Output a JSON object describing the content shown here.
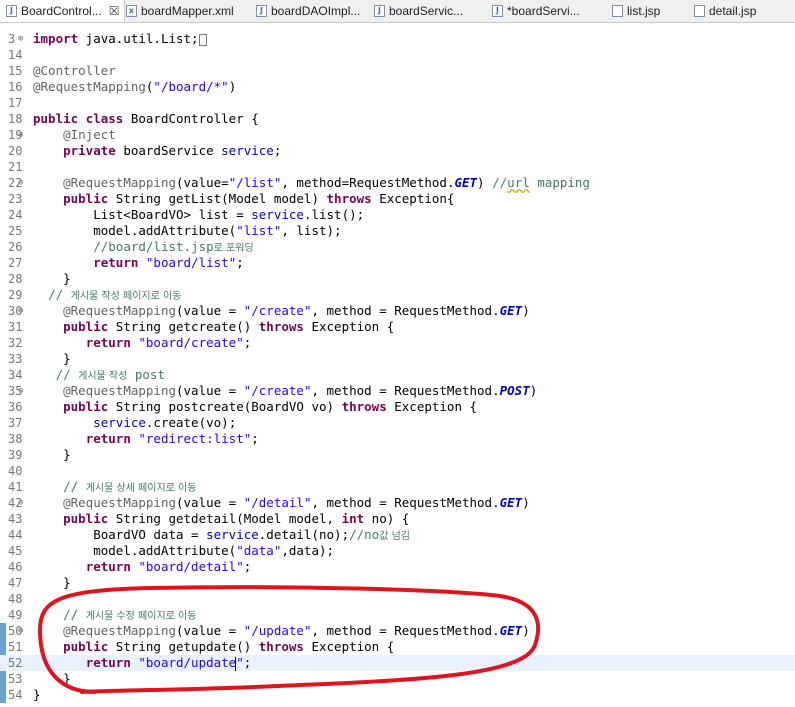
{
  "tabs": [
    {
      "label": "BoardControl...",
      "icon": "java-file-icon",
      "active": true
    },
    {
      "label": "boardMapper.xml",
      "icon": "xml-file-icon",
      "active": false
    },
    {
      "label": "boardDAOImpl...",
      "icon": "java-file-icon",
      "active": false
    },
    {
      "label": "boardServic...",
      "icon": "java-file-icon",
      "active": false
    },
    {
      "label": "*boardServi...",
      "icon": "java-file-icon",
      "active": false
    },
    {
      "label": "list.jsp",
      "icon": "jsp-file-icon",
      "active": false
    },
    {
      "label": "detail.jsp",
      "icon": "jsp-file-icon",
      "active": false
    }
  ],
  "tab_close_glyph": "☒",
  "lines": [
    {
      "n": "3",
      "fold": "⊕",
      "tokens": [
        [
          "kw",
          "import"
        ],
        [
          "tx",
          " java.util.List;"
        ]
      ]
    },
    {
      "n": "14",
      "tokens": []
    },
    {
      "n": "15",
      "tokens": [
        [
          "an",
          "@Controller"
        ]
      ]
    },
    {
      "n": "16",
      "tokens": [
        [
          "an",
          "@RequestMapping"
        ],
        [
          "tx",
          "("
        ],
        [
          "str",
          "\"/board/*\""
        ],
        [
          "tx",
          ")"
        ]
      ]
    },
    {
      "n": "17",
      "tokens": []
    },
    {
      "n": "18",
      "tokens": [
        [
          "kw",
          "public"
        ],
        [
          "tx",
          " "
        ],
        [
          "kw",
          "class"
        ],
        [
          "tx",
          " BoardController {"
        ]
      ]
    },
    {
      "n": "19",
      "fold": "⊖",
      "tokens": [
        [
          "tx",
          "    "
        ],
        [
          "an",
          "@Inject"
        ]
      ]
    },
    {
      "n": "20",
      "tokens": [
        [
          "tx",
          "    "
        ],
        [
          "kw",
          "private"
        ],
        [
          "tx",
          " boardService "
        ],
        [
          "fld",
          "service"
        ],
        [
          "tx",
          ";"
        ]
      ]
    },
    {
      "n": "21",
      "tokens": []
    },
    {
      "n": "22",
      "fold": "⊖",
      "tokens": [
        [
          "tx",
          "    "
        ],
        [
          "an",
          "@RequestMapping"
        ],
        [
          "tx",
          "(value="
        ],
        [
          "str",
          "\"/list\""
        ],
        [
          "tx",
          ", method=RequestMethod."
        ],
        [
          "cst",
          "GET"
        ],
        [
          "tx",
          ") "
        ],
        [
          "cm",
          "//"
        ],
        [
          "cmsq",
          "url"
        ],
        [
          "cm",
          " mapping"
        ]
      ]
    },
    {
      "n": "23",
      "tokens": [
        [
          "tx",
          "    "
        ],
        [
          "kw",
          "public"
        ],
        [
          "tx",
          " String getList(Model model) "
        ],
        [
          "kw",
          "throws"
        ],
        [
          "tx",
          " Exception{"
        ]
      ]
    },
    {
      "n": "24",
      "tokens": [
        [
          "tx",
          "        List<BoardVO> list = "
        ],
        [
          "fld",
          "service"
        ],
        [
          "tx",
          ".list();"
        ]
      ]
    },
    {
      "n": "25",
      "tokens": [
        [
          "tx",
          "        model.addAttribute("
        ],
        [
          "str",
          "\"list\""
        ],
        [
          "tx",
          ", list);"
        ]
      ]
    },
    {
      "n": "26",
      "tokens": [
        [
          "tx",
          "        "
        ],
        [
          "cm",
          "//board/list.jsp"
        ],
        [
          "cmk",
          "로 포워딩"
        ]
      ]
    },
    {
      "n": "27",
      "tokens": [
        [
          "tx",
          "        "
        ],
        [
          "kw",
          "return"
        ],
        [
          "tx",
          " "
        ],
        [
          "str",
          "\"board/list\""
        ],
        [
          "tx",
          ";"
        ]
      ]
    },
    {
      "n": "28",
      "tokens": [
        [
          "tx",
          "    }"
        ]
      ]
    },
    {
      "n": "29",
      "tokens": [
        [
          "tx",
          "  "
        ],
        [
          "cm",
          "// "
        ],
        [
          "cmk",
          "게시물 작성 페이지로 이동"
        ]
      ]
    },
    {
      "n": "30",
      "fold": "⊖",
      "tokens": [
        [
          "tx",
          "    "
        ],
        [
          "an",
          "@RequestMapping"
        ],
        [
          "tx",
          "(value = "
        ],
        [
          "str",
          "\"/create\""
        ],
        [
          "tx",
          ", method = RequestMethod."
        ],
        [
          "cst",
          "GET"
        ],
        [
          "tx",
          ")"
        ]
      ]
    },
    {
      "n": "31",
      "tokens": [
        [
          "tx",
          "    "
        ],
        [
          "kw",
          "public"
        ],
        [
          "tx",
          " String getcreate() "
        ],
        [
          "kw",
          "throws"
        ],
        [
          "tx",
          " Exception {"
        ]
      ]
    },
    {
      "n": "32",
      "tokens": [
        [
          "tx",
          "       "
        ],
        [
          "kw",
          "return"
        ],
        [
          "tx",
          " "
        ],
        [
          "str",
          "\"board/create\""
        ],
        [
          "tx",
          ";"
        ]
      ]
    },
    {
      "n": "33",
      "tokens": [
        [
          "tx",
          "    }"
        ]
      ]
    },
    {
      "n": "34",
      "tokens": [
        [
          "tx",
          "   "
        ],
        [
          "cm",
          "// "
        ],
        [
          "cmk",
          "게시물 작성"
        ],
        [
          "cm",
          " post"
        ]
      ]
    },
    {
      "n": "35",
      "fold": "⊖",
      "tokens": [
        [
          "tx",
          "    "
        ],
        [
          "an",
          "@RequestMapping"
        ],
        [
          "tx",
          "(value = "
        ],
        [
          "str",
          "\"/create\""
        ],
        [
          "tx",
          ", method = RequestMethod."
        ],
        [
          "cst",
          "POST"
        ],
        [
          "tx",
          ")"
        ]
      ]
    },
    {
      "n": "36",
      "tokens": [
        [
          "tx",
          "    "
        ],
        [
          "kw",
          "public"
        ],
        [
          "tx",
          " String postcreate(BoardVO vo) "
        ],
        [
          "kw",
          "throws"
        ],
        [
          "tx",
          " Exception {"
        ]
      ]
    },
    {
      "n": "37",
      "tokens": [
        [
          "tx",
          "        "
        ],
        [
          "fld",
          "service"
        ],
        [
          "tx",
          ".create(vo);"
        ]
      ]
    },
    {
      "n": "38",
      "tokens": [
        [
          "tx",
          "       "
        ],
        [
          "kw",
          "return"
        ],
        [
          "tx",
          " "
        ],
        [
          "str",
          "\"redirect:list\""
        ],
        [
          "tx",
          ";"
        ]
      ]
    },
    {
      "n": "39",
      "tokens": [
        [
          "tx",
          "    }"
        ]
      ]
    },
    {
      "n": "40",
      "tokens": []
    },
    {
      "n": "41",
      "tokens": [
        [
          "tx",
          "    "
        ],
        [
          "cm",
          "// "
        ],
        [
          "cmk",
          "게시물 상세 페이지로 이동"
        ]
      ]
    },
    {
      "n": "42",
      "fold": "⊖",
      "tokens": [
        [
          "tx",
          "    "
        ],
        [
          "an",
          "@RequestMapping"
        ],
        [
          "tx",
          "(value = "
        ],
        [
          "str",
          "\"/detail\""
        ],
        [
          "tx",
          ", method = RequestMethod."
        ],
        [
          "cst",
          "GET"
        ],
        [
          "tx",
          ")"
        ]
      ]
    },
    {
      "n": "43",
      "tokens": [
        [
          "tx",
          "    "
        ],
        [
          "kw",
          "public"
        ],
        [
          "tx",
          " String getdetail(Model model, "
        ],
        [
          "kw",
          "int"
        ],
        [
          "tx",
          " no) {"
        ]
      ]
    },
    {
      "n": "44",
      "tokens": [
        [
          "tx",
          "        BoardVO data = "
        ],
        [
          "fld",
          "service"
        ],
        [
          "tx",
          ".detail(no);"
        ],
        [
          "cm",
          "//no"
        ],
        [
          "cmk",
          "값 넘김"
        ]
      ]
    },
    {
      "n": "45",
      "tokens": [
        [
          "tx",
          "        model.addAttribute("
        ],
        [
          "str",
          "\"data\""
        ],
        [
          "tx",
          ",data);"
        ]
      ]
    },
    {
      "n": "46",
      "tokens": [
        [
          "tx",
          "       "
        ],
        [
          "kw",
          "return"
        ],
        [
          "tx",
          " "
        ],
        [
          "str",
          "\"board/detail\""
        ],
        [
          "tx",
          ";"
        ]
      ]
    },
    {
      "n": "47",
      "tokens": [
        [
          "tx",
          "    }"
        ]
      ]
    },
    {
      "n": "48",
      "tokens": []
    },
    {
      "n": "49",
      "tokens": [
        [
          "tx",
          "    "
        ],
        [
          "cm",
          "// "
        ],
        [
          "cmk",
          "게시물 수정 페이지로 이동"
        ]
      ]
    },
    {
      "n": "50",
      "fold": "⊖",
      "tokens": [
        [
          "tx",
          "    "
        ],
        [
          "an",
          "@RequestMapping"
        ],
        [
          "tx",
          "(value = "
        ],
        [
          "str",
          "\"/update\""
        ],
        [
          "tx",
          ", method = RequestMethod."
        ],
        [
          "cst",
          "GET"
        ],
        [
          "tx",
          ")"
        ]
      ]
    },
    {
      "n": "51",
      "tokens": [
        [
          "tx",
          "    "
        ],
        [
          "kw",
          "public"
        ],
        [
          "tx",
          " String getupdate() "
        ],
        [
          "kw",
          "throws"
        ],
        [
          "tx",
          " Exception {"
        ]
      ]
    },
    {
      "n": "52",
      "current": true,
      "tokens": [
        [
          "tx",
          "       "
        ],
        [
          "kw",
          "return"
        ],
        [
          "tx",
          " "
        ],
        [
          "str",
          "\"board/update"
        ],
        [
          "caret",
          ""
        ],
        [
          "str",
          "\""
        ],
        [
          "tx",
          ";"
        ]
      ]
    },
    {
      "n": "53",
      "tokens": [
        [
          "tx",
          "    }"
        ]
      ]
    },
    {
      "n": "54",
      "tokens": [
        [
          "tx",
          "}"
        ]
      ]
    }
  ],
  "colors": {
    "keyword": "#7f0055",
    "annotation": "#646464",
    "string": "#2a00ff",
    "comment": "#3f7f5f",
    "constant": "#0000c0",
    "highlight_ink": "#e0141e",
    "change_marker": "#6ba2d6"
  }
}
